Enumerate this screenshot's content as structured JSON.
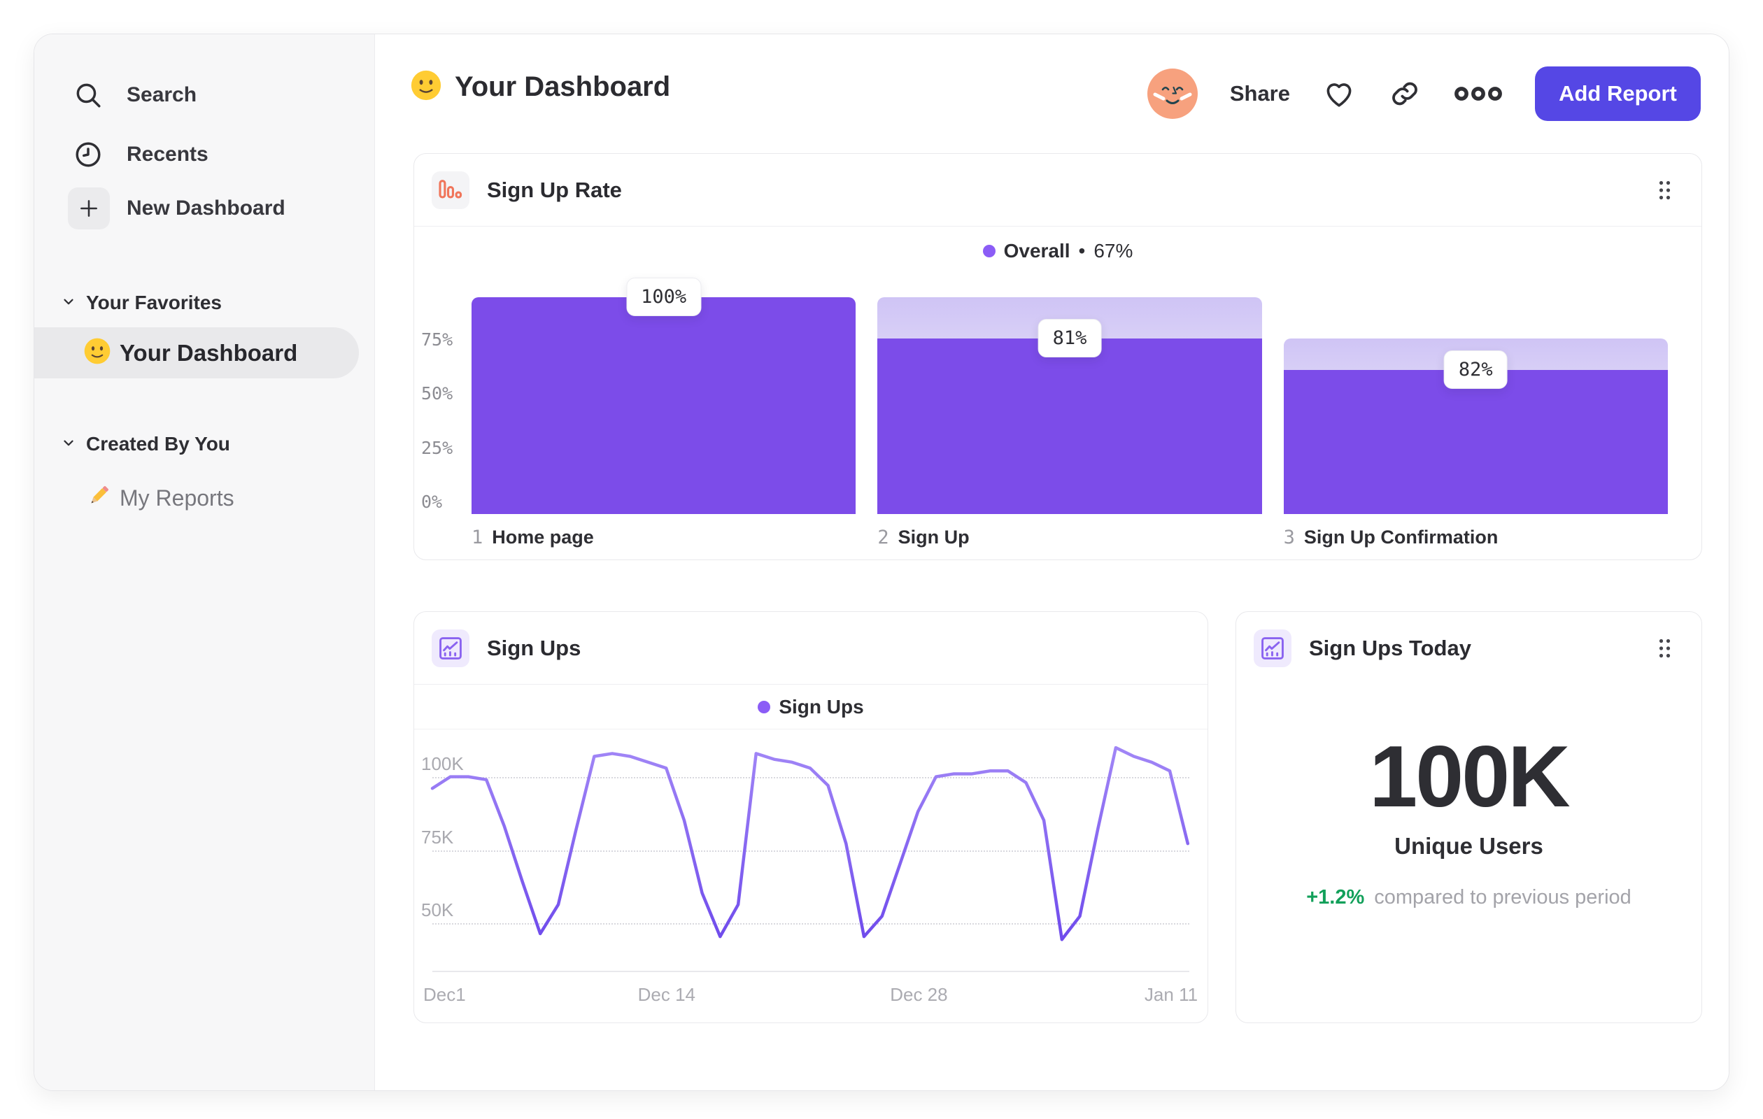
{
  "header": {
    "title": "Your Dashboard",
    "share_label": "Share",
    "add_report_label": "Add Report"
  },
  "sidebar": {
    "search_label": "Search",
    "recents_label": "Recents",
    "new_dashboard_label": "New Dashboard",
    "favorites_section": "Your Favorites",
    "favorite_item": "Your Dashboard",
    "created_section": "Created By You",
    "created_item": "My Reports"
  },
  "cards": {
    "funnel": {
      "title": "Sign Up Rate",
      "legend_label": "Overall",
      "legend_separator": "•",
      "legend_value": "67%"
    },
    "line": {
      "title": "Sign Ups",
      "legend_label": "Sign Ups"
    },
    "stat": {
      "title": "Sign Ups Today",
      "value": "100K",
      "value_label": "Unique Users",
      "delta": "+1.2%",
      "delta_note": "compared to previous period"
    }
  },
  "colors": {
    "bar_purple": "#7C4CE9",
    "line_purple": "#7B57F2",
    "legend_dot_purple": "#8B5CF6",
    "button_purple": "#5547E5",
    "positive_green": "#12A05A",
    "funnel_icon_coral": "#F0755A",
    "chart_icon_purple": "#8A63F0"
  },
  "chart_data": [
    {
      "type": "bar",
      "subtype": "funnel-steps",
      "title": "Sign Up Rate",
      "legend": "Overall",
      "overall_conversion": "67%",
      "step_numbers": [
        "1",
        "2",
        "3"
      ],
      "categories": [
        "Home page",
        "Sign Up",
        "Sign Up Confirmation"
      ],
      "values_pct_of_previous": [
        100,
        81,
        82
      ],
      "bar_labels": [
        "100%",
        "81%",
        "82%"
      ],
      "y_ticks": [
        {
          "label": "75%",
          "pct": 75
        },
        {
          "label": "50%",
          "pct": 50
        },
        {
          "label": "25%",
          "pct": 25
        },
        {
          "label": "0%",
          "pct": 0
        }
      ],
      "ylim": [
        0,
        100
      ],
      "grid": false,
      "legend_position": "top-center"
    },
    {
      "type": "line",
      "title": "Sign Ups",
      "series": [
        {
          "name": "Sign Ups",
          "values_k": [
            96,
            100,
            100,
            99,
            83,
            64,
            46,
            56,
            82,
            107,
            108,
            107,
            105,
            103,
            85,
            60,
            45,
            56,
            108,
            106,
            105,
            103,
            97,
            77,
            45,
            52,
            70,
            88,
            100,
            101,
            101,
            102,
            102,
            98,
            85,
            44,
            52,
            82,
            110,
            107,
            105,
            102,
            77
          ]
        }
      ],
      "x_unit": "day",
      "x_range": "Dec 1 – Jan 12",
      "x_ticks": [
        {
          "label": "Dec1",
          "day": 0
        },
        {
          "label": "Dec 14",
          "day": 13
        },
        {
          "label": "Dec 28",
          "day": 27
        },
        {
          "label": "Jan 11",
          "day": 41
        }
      ],
      "y_ticks": [
        {
          "label": "100K",
          "value": 100
        },
        {
          "label": "75K",
          "value": 75
        },
        {
          "label": "50K",
          "value": 50
        }
      ],
      "ylim_k": [
        33,
        115
      ],
      "grid": "dotted-horizontal",
      "legend_position": "top-center"
    }
  ]
}
